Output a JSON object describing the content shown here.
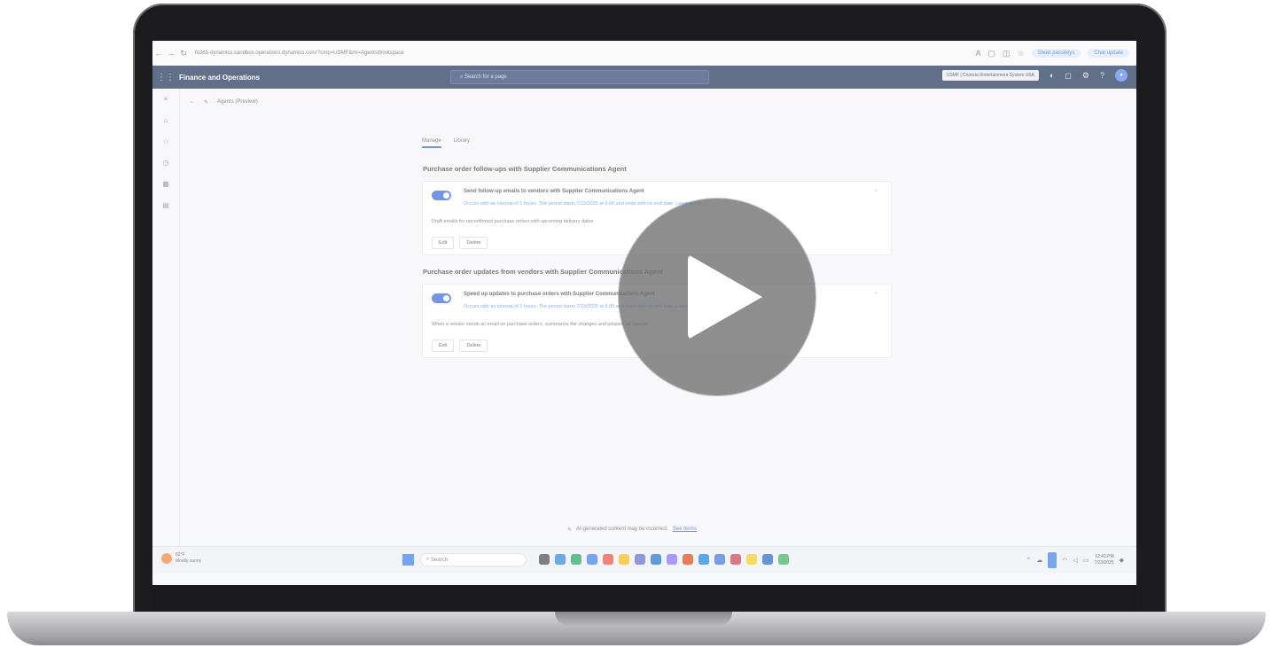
{
  "browser": {
    "url": "fo365-dynamics.sandbox.operations.dynamics.com/?cmp=USMF&mi=AgentsWorkspace",
    "profile_label": "Show passkeys",
    "update_label": "Chat update"
  },
  "app": {
    "title": "Finance and Operations",
    "search_placeholder": "Search for a page",
    "company": "USMF | Contoso Entertainment System USA"
  },
  "breadcrumb": {
    "page": "Agents (Preview)"
  },
  "tabs": [
    {
      "label": "Manage"
    },
    {
      "label": "Library"
    }
  ],
  "sections": [
    {
      "title": "Purchase order follow-ups with Supplier Communications Agent",
      "card": {
        "heading": "Send follow-up emails to vendors with Supplier Communications Agent",
        "subtext": "Occurs with an interval of 1 hours. The period starts 7/23/2025 at 6:00 and ends with no end date. Learn more",
        "description": "Draft emails for unconfirmed purchase orders with upcoming delivery dates",
        "edit_label": "Edit",
        "delete_label": "Delete"
      }
    },
    {
      "title": "Purchase order updates from vendors with Supplier Communications Agent",
      "card": {
        "heading": "Speed up updates to purchase orders with Supplier Communications Agent",
        "subtext": "Occurs with an interval of 1 hours. The period starts 7/23/2025 at 6:00 and ends with no end date. Learn more",
        "description": "When a vendor sends an email on purchase orders, summarize the changes and prepare an update",
        "edit_label": "Edit",
        "delete_label": "Delete"
      }
    }
  ],
  "footer": {
    "ai_note": "AI-generated content may be incorrect.",
    "terms_link": "See terms"
  },
  "taskbar": {
    "weather_temp": "82°F",
    "weather_desc": "Mostly sunny",
    "search_placeholder": "Search",
    "time": "12:43 PM",
    "date": "7/23/2025",
    "app_colors": [
      "#3a3a3a",
      "#1a7fd6",
      "#0f9d58",
      "#2f76e3",
      "#e94235",
      "#f4b400",
      "#5b5fc7",
      "#0a66c2",
      "#7b61ff",
      "#d83b01",
      "#0078d4",
      "#3367d6",
      "#c4314b",
      "#f2c811",
      "#185abd",
      "#33a852"
    ]
  }
}
